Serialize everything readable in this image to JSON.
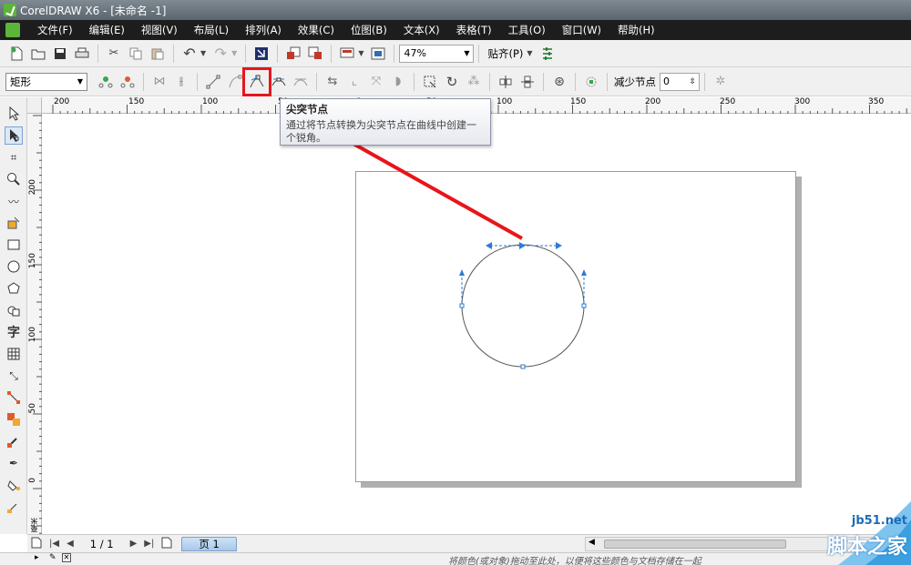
{
  "window": {
    "title": "CorelDRAW X6 - [未命名 -1]"
  },
  "menu": [
    "文件(F)",
    "编辑(E)",
    "视图(V)",
    "布局(L)",
    "排列(A)",
    "效果(C)",
    "位图(B)",
    "文本(X)",
    "表格(T)",
    "工具(O)",
    "窗口(W)",
    "帮助(H)"
  ],
  "toolbar": {
    "zoom": "47%",
    "snap_label": "贴齐(P)"
  },
  "property_bar": {
    "shape_select": "矩形",
    "reduce_nodes_label": "减少节点",
    "reduce_nodes_value": "0"
  },
  "tooltip": {
    "title": "尖突节点",
    "body": "通过将节点转换为尖突节点在曲线中创建一个锐角。"
  },
  "ruler_top_labels": [
    "200",
    "150",
    "100",
    "50",
    "0",
    "50",
    "100",
    "150",
    "200",
    "250",
    "300",
    "350"
  ],
  "ruler_left_labels": [
    "200",
    "150",
    "100",
    "50",
    "0"
  ],
  "ruler_unit": "毫米",
  "page_nav": {
    "count": "1 / 1",
    "tab": "页 1"
  },
  "status": {
    "hint": "将颜色(或对象)拖动至此处，以便将这些颜色与文档存储在一起"
  },
  "watermark": {
    "site": "jb51.net",
    "name": "脚本之家"
  },
  "colors": {
    "accent_red": "#e8151b",
    "node_blue": "#2c7bd6",
    "menubar": "#1d1d1d"
  }
}
